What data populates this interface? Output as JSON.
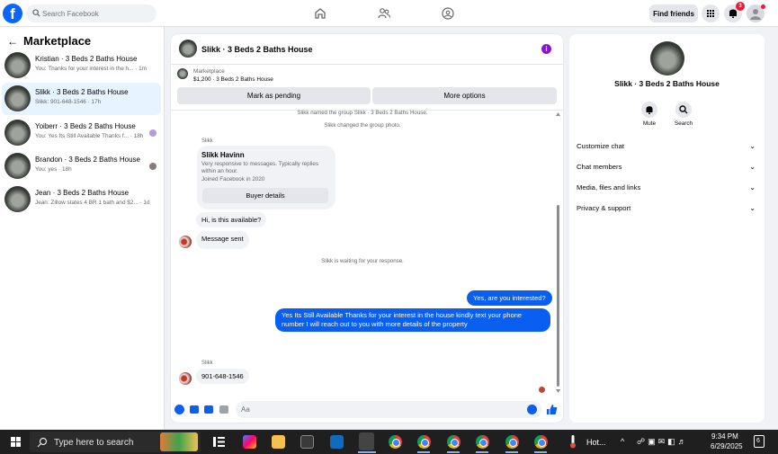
{
  "topbar": {
    "search_placeholder": "Search Facebook",
    "find_friends": "Find friends",
    "notification_count": "3"
  },
  "sidebar": {
    "title": "Marketplace",
    "conversations": [
      {
        "name": "Kristian · 3 Beds 2 Baths House",
        "snippet": "You: Thanks for your interest in the h... · 1m",
        "active": false
      },
      {
        "name": "Slikk · 3 Beds 2 Baths House",
        "snippet": "Slikk: 901-648-1546 · 17h",
        "active": true
      },
      {
        "name": "Yoiberr · 3 Beds 2 Baths House",
        "snippet": "You: Yes Its Still Available Thanks f... · 18h",
        "active": false
      },
      {
        "name": "Brandon · 3 Beds 2 Baths House",
        "snippet": "You: yes · 18h",
        "active": false
      },
      {
        "name": "Jean · 3 Beds 2 Baths House",
        "snippet": "Jean: Zillow states 4 BR 1 bath and $2... · 1d",
        "active": false
      }
    ]
  },
  "chat": {
    "title": "Slikk · 3 Beds 2 Baths House",
    "listing_category": "Marketplace",
    "listing_price": "$1,200 · 3 Beds 2 Baths House",
    "mark_pending": "Mark as pending",
    "more_options": "More options",
    "system_named": "Slikk named the group Slikk · 3 Beds 2 Baths House.",
    "system_photo": "Slikk changed the group photo.",
    "sender_label": "Slikk",
    "card_name": "Slikk Havinn",
    "card_desc": "Very responsive to messages. Typically replies within an hour.",
    "card_joined": "Joined Facebook in 2020",
    "buyer_details": "Buyer details",
    "msg_available": "Hi, is this available?",
    "msg_sent": "Message sent",
    "system_waiting": "Slikk is waiting for your response.",
    "msg_interested": "Yes, are you interested?",
    "msg_reply": "Yes Its Still Available Thanks for your interest in the house kindly text your phone number I will reach out to you with more details of the property",
    "sender_label2": "Slikk",
    "msg_phone": "901-648-1546",
    "input_placeholder": "Aa"
  },
  "details": {
    "name": "Slikk · 3 Beds 2 Baths House",
    "mute_label": "Mute",
    "search_label": "Search",
    "items": [
      "Customize chat",
      "Chat members",
      "Media, files and links",
      "Privacy & support"
    ]
  },
  "taskbar": {
    "search_placeholder": "Type here to search",
    "weather": "Hot...",
    "time": "9:34 PM",
    "date": "6/29/2025",
    "notif_count": "6"
  },
  "colors": {
    "accent": "#0866ff",
    "outgoing_bubble": "#0a5ef0",
    "badge": "#e41e3f"
  }
}
